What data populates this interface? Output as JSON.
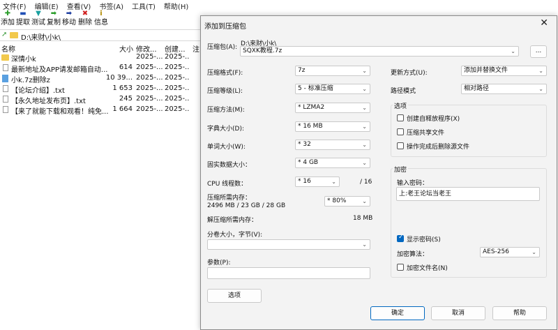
{
  "menu": [
    "文件(F)",
    "编辑(E)",
    "查看(V)",
    "书签(A)",
    "工具(T)",
    "帮助(H)"
  ],
  "toolbar": [
    {
      "label": "添加",
      "icon": "plus-icon",
      "glyph": "✚",
      "color": "#2a9d2a"
    },
    {
      "label": "提取",
      "icon": "minus-icon",
      "glyph": "▬",
      "color": "#1f4fb5"
    },
    {
      "label": "测试",
      "icon": "test-icon",
      "glyph": "▼",
      "color": "#1aa0a0"
    },
    {
      "label": "复制",
      "icon": "copy-arrow-icon",
      "glyph": "➡",
      "color": "#2a9d2a"
    },
    {
      "label": "移动",
      "icon": "move-arrow-icon",
      "glyph": "➡",
      "color": "#1f3fa0"
    },
    {
      "label": "删除",
      "icon": "delete-icon",
      "glyph": "✖",
      "color": "#d02020"
    },
    {
      "label": "信息",
      "icon": "info-icon",
      "glyph": "i",
      "color": "#b08a00"
    }
  ],
  "path": "D:\\来财\\小k\\",
  "columns": {
    "name": "名称",
    "size": "大小",
    "modified": "修改...",
    "created": "创建...",
    "note": "注"
  },
  "files": [
    {
      "name": "深情小k",
      "size": "",
      "modified": "2025-...",
      "created": "2025-...",
      "type": "folder"
    },
    {
      "name": "最新地址及APP请发邮箱自动...",
      "size": "614",
      "modified": "2025-...",
      "created": "2025-...",
      "type": "file"
    },
    {
      "name": "小k.7z删除z",
      "size": "10 39...",
      "modified": "2025-...",
      "created": "2025-...",
      "type": "archive"
    },
    {
      "name": "【论坛介绍】.txt",
      "size": "1 653",
      "modified": "2025-...",
      "created": "2025-...",
      "type": "file"
    },
    {
      "name": "【永久地址发布页】.txt",
      "size": "245",
      "modified": "2025-...",
      "created": "2025-...",
      "type": "file"
    },
    {
      "name": "【来了就能下载和观看！纯免...",
      "size": "1 664",
      "modified": "2025-...",
      "created": "2025-...",
      "type": "file"
    }
  ],
  "dialog": {
    "title": "添加到压缩包",
    "close": "✕",
    "archive_label": "压缩包(A):",
    "archive_dir": "D:\\来财\\小k\\",
    "archive_name": "SQXK教程.7z",
    "browse": "...",
    "format_label": "压缩格式(F):",
    "format": "7z",
    "level_label": "压缩等级(L):",
    "level": "5 - 标准压缩",
    "method_label": "压缩方法(M):",
    "method": "* LZMA2",
    "dict_label": "字典大小(D):",
    "dict": "* 16 MB",
    "word_label": "单词大小(W):",
    "word": "* 32",
    "solid_label": "固实数据大小：",
    "solid": "* 4 GB",
    "cpu_label": "CPU 线程数：",
    "cpu": "* 16",
    "cpu_total": "/ 16",
    "mem_comp_label": "压缩所需内存：",
    "mem_comp_value": "2496 MB / 23 GB / 28 GB",
    "mem_percent": "* 80%",
    "mem_decomp_label": "解压缩所需内存：",
    "mem_decomp_value": "18 MB",
    "split_label": "分卷大小，字节(V):",
    "split_value": "",
    "params_label": "参数(P):",
    "params_value": "",
    "options_button": "选项",
    "update_label": "更新方式(U):",
    "update": "添加并替换文件",
    "pathmode_label": "路径模式",
    "pathmode": "相对路径",
    "options_group": "选项",
    "opt_sfx": "创建自释放程序(X)",
    "opt_shared": "压缩共享文件",
    "opt_delete": "操作完成后删除源文件",
    "encrypt_group": "加密",
    "password_label": "输入密码：",
    "password": "上:老王论坛当老王",
    "show_password": "显示密码(S)",
    "enc_method_label": "加密算法：",
    "enc_method": "AES-256",
    "enc_names": "加密文件名(N)",
    "ok": "确定",
    "cancel": "取消",
    "help": "帮助"
  }
}
